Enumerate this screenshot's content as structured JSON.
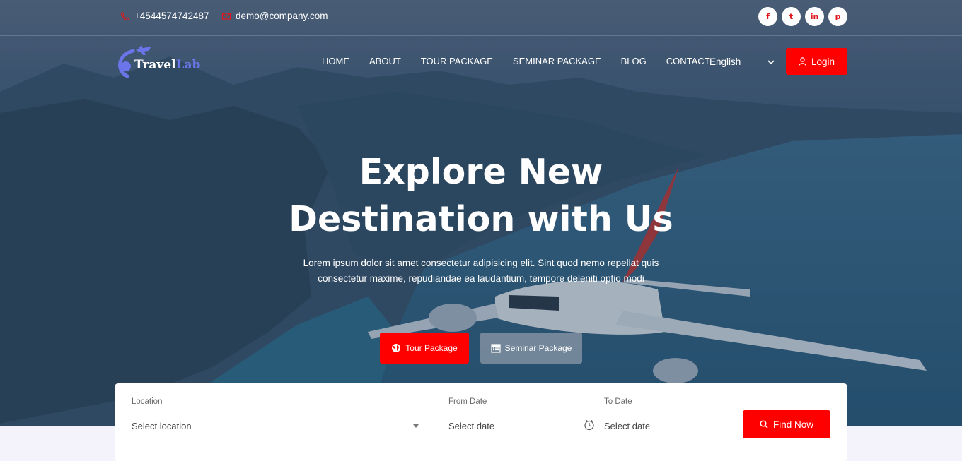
{
  "topbar": {
    "phone": "+4544574742487",
    "email": "demo@company.com",
    "socials": [
      {
        "icon": "facebook-icon",
        "glyph": "f"
      },
      {
        "icon": "twitter-icon",
        "glyph": "t"
      },
      {
        "icon": "linkedin-icon",
        "glyph": "in"
      },
      {
        "icon": "pinterest-icon",
        "glyph": "p"
      }
    ]
  },
  "brand": {
    "part1": "Travel",
    "part2": "Lab"
  },
  "nav": [
    "HOME",
    "ABOUT",
    "TOUR PACKAGE",
    "SEMINAR PACKAGE",
    "BLOG",
    "CONTACT"
  ],
  "language": {
    "selected": "English"
  },
  "login_label": "Login",
  "hero": {
    "title_line1": "Explore New",
    "title_line2": "Destination with Us",
    "subtitle_line1": "Lorem ipsum dolor sit amet consectetur adipisicing elit. Sint quod nemo repellat quis",
    "subtitle_line2": "consectetur maxime, repudiandae ea laudantium, tempore deleniti optio modi",
    "tour_button": "Tour Package",
    "seminar_button": "Seminar Package"
  },
  "search": {
    "location_label": "Location",
    "location_placeholder": "Select location",
    "from_label": "From Date",
    "from_placeholder": "Select date",
    "to_label": "To Date",
    "to_placeholder": "Select date",
    "find_label": "Find Now"
  },
  "colors": {
    "accent": "#ff0000",
    "brand_secondary": "#6b74e8"
  }
}
